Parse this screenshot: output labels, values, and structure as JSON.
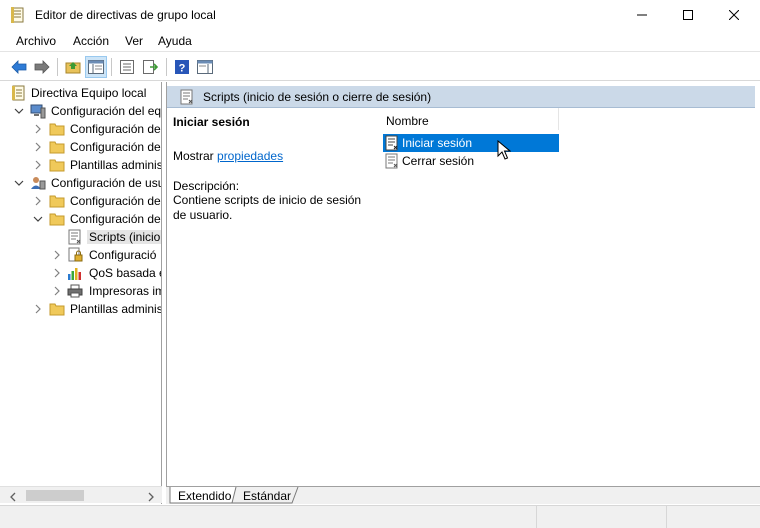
{
  "window": {
    "title": "Editor de directivas de grupo local"
  },
  "menu": {
    "items": [
      "Archivo",
      "Acción",
      "Ver",
      "Ayuda"
    ]
  },
  "toolbar": {
    "buttons": [
      "back-icon",
      "forward-icon",
      "up-folder-icon",
      "show-hide-tree-icon",
      "properties-icon",
      "export-list-icon",
      "help-icon",
      "show-hide-action-pane-icon"
    ]
  },
  "tree": {
    "items": [
      {
        "label": "Directiva Equipo local"
      },
      {
        "label": "Configuración del eq"
      },
      {
        "label": "Configuración de"
      },
      {
        "label": "Configuración de"
      },
      {
        "label": "Plantillas adminis"
      },
      {
        "label": "Configuración de usu"
      },
      {
        "label": "Configuración de"
      },
      {
        "label": "Configuración de"
      },
      {
        "label": "Scripts (inicio"
      },
      {
        "label": "Configuració"
      },
      {
        "label": "QoS basada e"
      },
      {
        "label": "Impresoras im"
      },
      {
        "label": "Plantillas adminis"
      }
    ]
  },
  "details": {
    "header_title": "Scripts (inicio de sesión o cierre de sesión)",
    "item_title": "Iniciar sesión",
    "show_prefix": "Mostrar",
    "show_link": "propiedades",
    "description_label": "Descripción:",
    "description_text": "Contiene scripts de inicio de sesión de usuario."
  },
  "list": {
    "column": "Nombre",
    "rows": [
      {
        "label": "Iniciar sesión",
        "selected": true
      },
      {
        "label": "Cerrar sesión",
        "selected": false
      }
    ]
  },
  "tabs": {
    "extended": "Extendido",
    "standard": "Estándar"
  },
  "colors": {
    "selection": "#0078d7",
    "header_band": "#cbd9e8",
    "link": "#0066cc"
  }
}
